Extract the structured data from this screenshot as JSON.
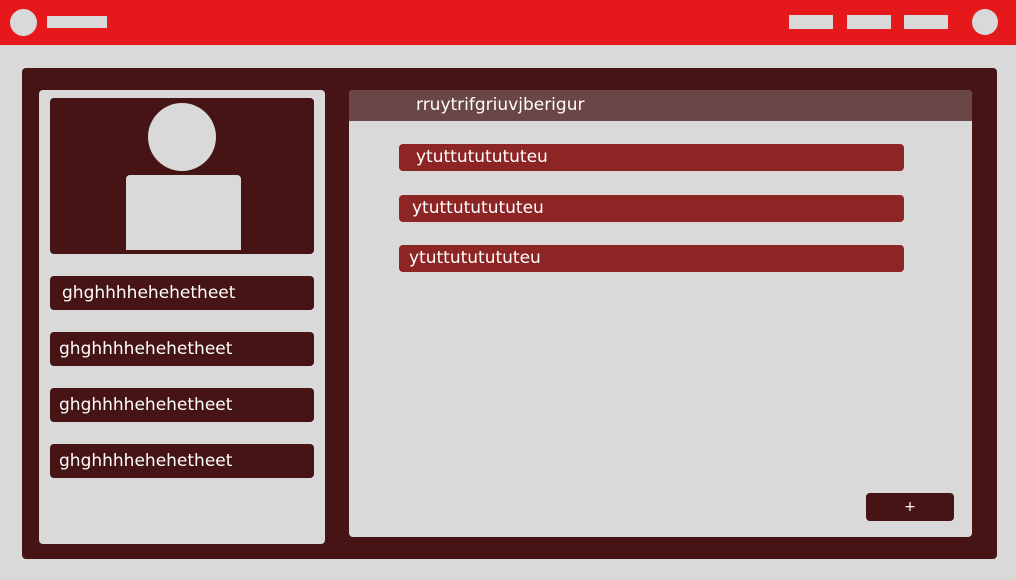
{
  "colors": {
    "topbar": "#e5191b",
    "frame": "#461414",
    "panel": "#d9d9d9",
    "header": "#6a4646",
    "item": "#8e2525"
  },
  "topbar": {
    "logo_icon": "circle-placeholder",
    "avatar_icon": "circle-placeholder"
  },
  "profile": {
    "icon": "user-silhouette"
  },
  "sidebar": {
    "items": [
      {
        "label": "ghghhhhehehetheet"
      },
      {
        "label": "ghghhhhehehetheet"
      },
      {
        "label": "ghghhhhehehetheet"
      },
      {
        "label": "ghghhhhehehetheet"
      }
    ]
  },
  "main": {
    "title": "rruytrifgriuvjberigur",
    "items": [
      {
        "label": "ytuttututututeu"
      },
      {
        "label": "ytuttututututeu"
      },
      {
        "label": "ytuttututututeu"
      }
    ],
    "add_label": "+"
  }
}
